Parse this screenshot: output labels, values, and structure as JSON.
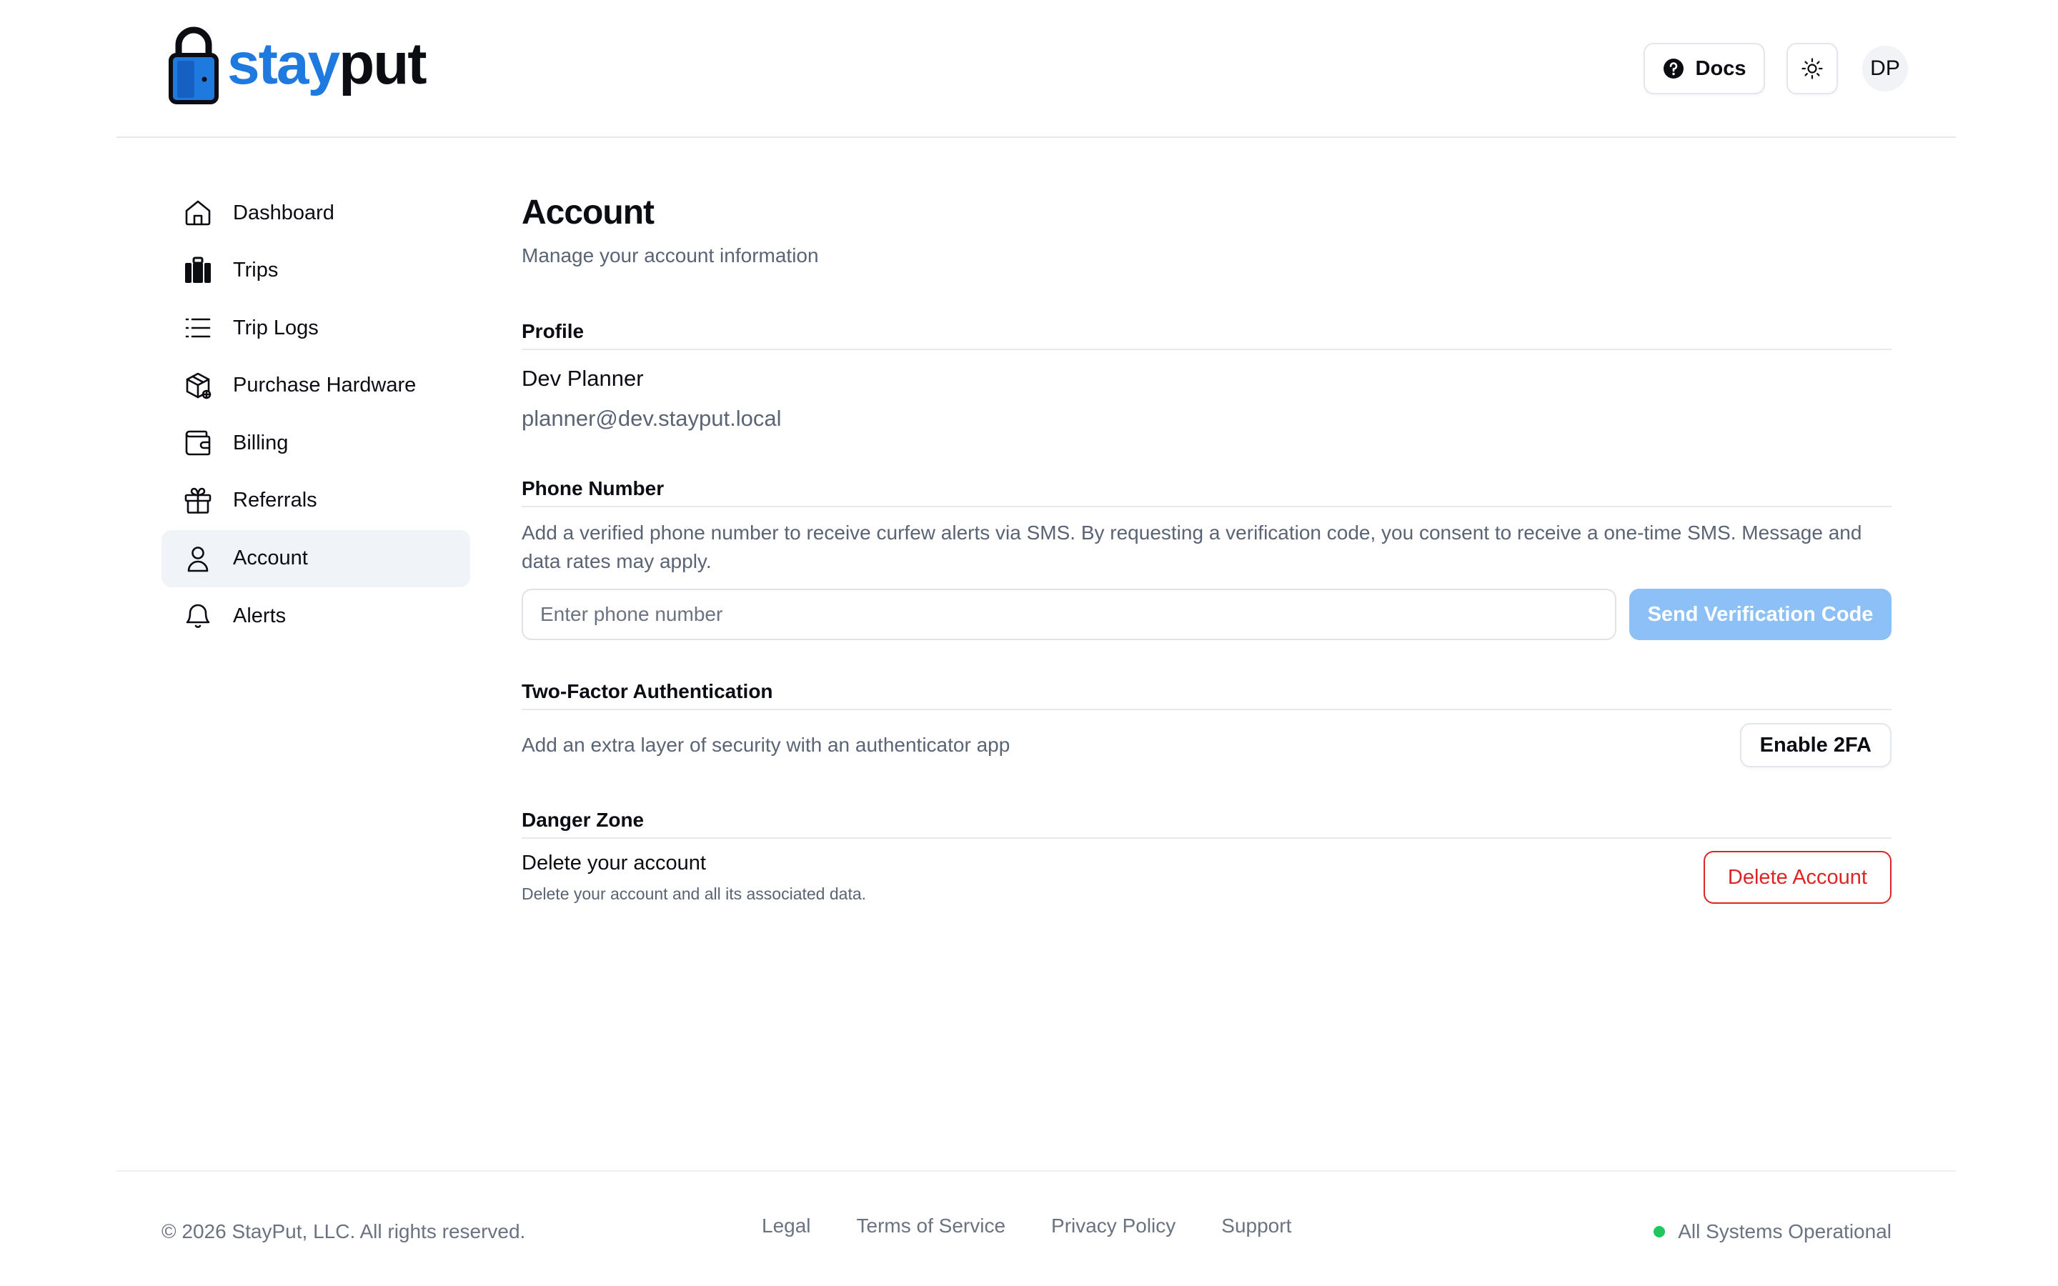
{
  "header": {
    "logo_part1": "stay",
    "logo_part2": "put",
    "docs_label": "Docs",
    "avatar_initials": "DP"
  },
  "sidebar": {
    "items": [
      {
        "label": "Dashboard",
        "icon": "home-icon"
      },
      {
        "label": "Trips",
        "icon": "luggage-icon"
      },
      {
        "label": "Trip Logs",
        "icon": "list-icon"
      },
      {
        "label": "Purchase Hardware",
        "icon": "package-icon"
      },
      {
        "label": "Billing",
        "icon": "wallet-icon"
      },
      {
        "label": "Referrals",
        "icon": "gift-icon"
      },
      {
        "label": "Account",
        "icon": "user-icon",
        "active": true
      },
      {
        "label": "Alerts",
        "icon": "bell-icon"
      }
    ]
  },
  "main": {
    "title": "Account",
    "subtitle": "Manage your account information",
    "profile": {
      "heading": "Profile",
      "name": "Dev Planner",
      "email": "planner@dev.stayput.local"
    },
    "phone": {
      "heading": "Phone Number",
      "description": "Add a verified phone number to receive curfew alerts via SMS. By requesting a verification code, you consent to receive a one-time SMS. Message and data rates may apply.",
      "placeholder": "Enter phone number",
      "value": "",
      "send_label": "Send Verification Code"
    },
    "two_factor": {
      "heading": "Two-Factor Authentication",
      "description": "Add an extra layer of security with an authenticator app",
      "button_label": "Enable 2FA"
    },
    "danger": {
      "heading": "Danger Zone",
      "title": "Delete your account",
      "subtitle": "Delete your account and all its associated data.",
      "button_label": "Delete Account"
    }
  },
  "footer": {
    "copyright": "© 2026 StayPut, LLC. All rights reserved.",
    "links": [
      "Legal",
      "Terms of Service",
      "Privacy Policy",
      "Support"
    ],
    "status": "All Systems Operational"
  },
  "colors": {
    "brand_blue": "#1f7ae0",
    "send_button_disabled": "#8cc0f6",
    "danger": "#dc2626",
    "status_ok": "#22c55e",
    "active_nav_bg": "#f0f3f7"
  }
}
